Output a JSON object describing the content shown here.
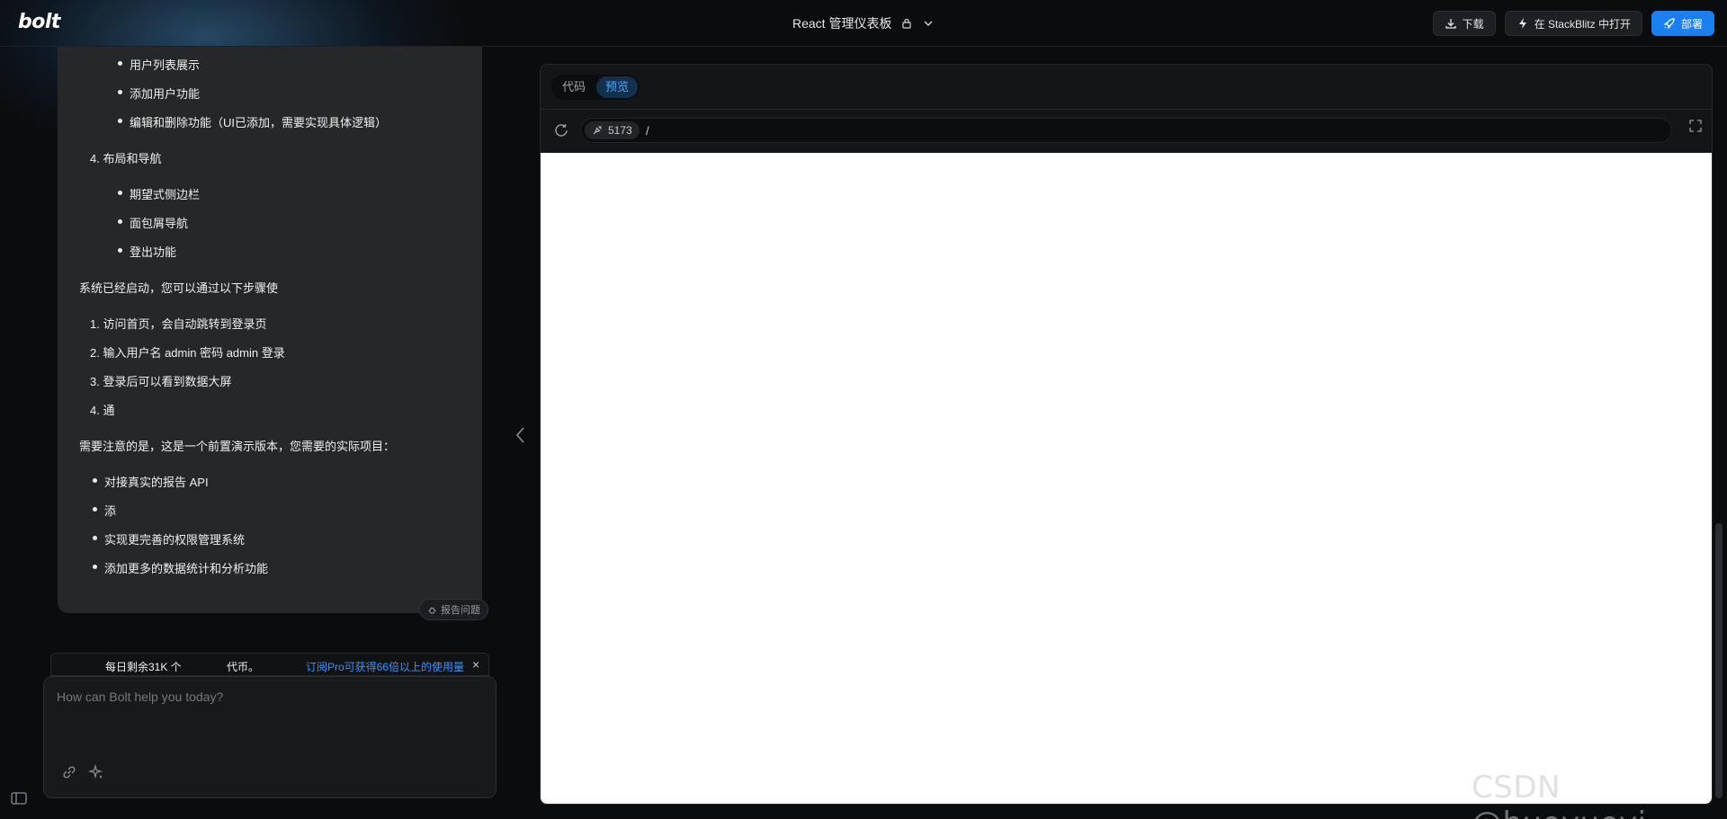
{
  "app": {
    "logo": "bolt"
  },
  "header": {
    "project_title": "React 管理仪表板",
    "download_label": "下载",
    "stackblitz_label": "在 StackBlitz 中打开",
    "deploy_label": "部署"
  },
  "chat": {
    "lines": [
      "用户列表展示",
      "添加用户功能",
      "编辑和删除功能（UI已添加，需要实现具体逻辑）",
      "4. 布局和导航",
      "期望式侧边栏",
      "面包屑导航",
      "登出功能",
      "系统已经启动，您可以通过以下步骤使",
      "1. 访问首页，会自动跳转到登录页",
      "2. 输入用户名 admin 密码 admin 登录",
      "3. 登录后可以看到数据大屏",
      "4. 通",
      "需要注意的是，这是一个前置演示版本，您需要的实际项目：",
      "对接真实的报告 API",
      "添",
      "实现更完善的权限管理系统",
      "添加更多的数据统计和分析功能"
    ],
    "report_label": "报告问题",
    "token_text_1": "每日剩余31K 个",
    "token_text_2": "代币。",
    "token_upgrade": "订阅Pro可获得66倍以上的使用量",
    "token_close": "×",
    "input_placeholder": "How can Bolt help you today?"
  },
  "workbench": {
    "tab_code": "代码",
    "tab_preview": "预览",
    "port": "5173",
    "path": "/"
  },
  "watermark": "CSDN @huoyueyi",
  "colors": {
    "accent": "#1a7ff0",
    "link": "#3a94ff",
    "panel": "#262729"
  }
}
